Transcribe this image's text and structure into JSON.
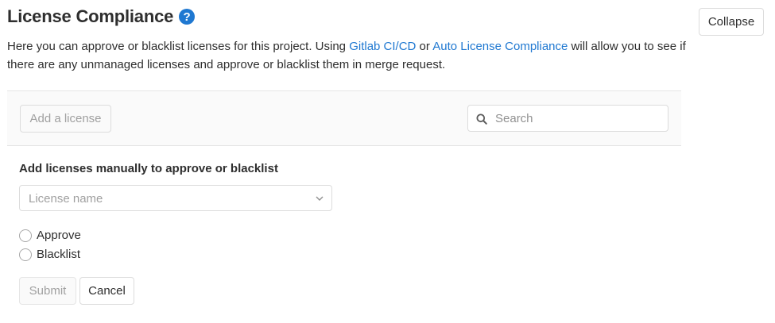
{
  "header": {
    "title": "License Compliance",
    "help_icon": "question-circle-icon",
    "help_glyph": "?",
    "collapse_label": "Collapse"
  },
  "description": {
    "part1": "Here you can approve or blacklist licenses for this project. Using ",
    "link1": "Gitlab CI/CD",
    "part2": " or ",
    "link2": "Auto License Compliance",
    "part3": " will allow you to see if there are any unmanaged licenses and approve or blacklist them in merge request.",
    "link_color": "#1f78d1"
  },
  "toolbar": {
    "add_label": "Add a license",
    "search_placeholder": "Search",
    "search_icon": "search-icon"
  },
  "form": {
    "heading": "Add licenses manually to approve or blacklist",
    "select_placeholder": "License name",
    "select_icon": "chevron-down-icon",
    "options": [
      {
        "label": "Approve",
        "checked": false
      },
      {
        "label": "Blacklist",
        "checked": false
      }
    ],
    "submit_label": "Submit",
    "cancel_label": "Cancel"
  },
  "colors": {
    "accent": "#1f78d1",
    "text": "#2e2e2e",
    "muted": "#a0a0a0",
    "border": "#dcdcdc",
    "toolbar_bg": "#fafafa"
  }
}
